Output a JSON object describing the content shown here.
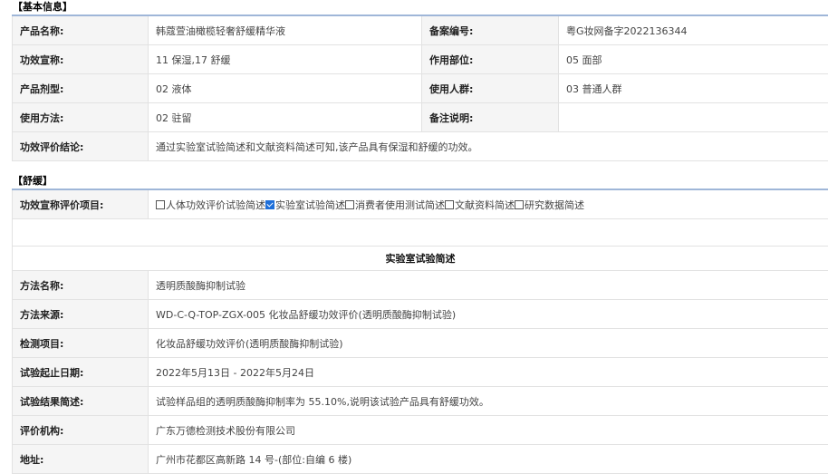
{
  "section1": {
    "title": "【基本信息】",
    "rows": [
      {
        "l1": "产品名称:",
        "v1": "韩蔻萱油橄榄轻奢舒缓精华液",
        "l2": "备案编号:",
        "v2": "粤G妆网备字2022136344"
      },
      {
        "l1": "功效宣称:",
        "v1": "11 保湿,17 舒缓",
        "l2": "作用部位:",
        "v2": "05 面部"
      },
      {
        "l1": "产品剂型:",
        "v1": "02 液体",
        "l2": "使用人群:",
        "v2": "03 普通人群"
      },
      {
        "l1": "使用方法:",
        "v1": "02 驻留",
        "l2": "备注说明:",
        "v2": ""
      }
    ],
    "conclusion_label": "功效评价结论:",
    "conclusion_value": "通过实验室试验简述和文献资料简述可知,该产品具有保湿和舒缓的功效。"
  },
  "section2": {
    "title": "【舒缓】",
    "items_label": "功效宣称评价项目:",
    "checkboxes": [
      {
        "label": "人体功效评价试验简述",
        "checked": false
      },
      {
        "label": "实验室试验简述",
        "checked": true
      },
      {
        "label": "消费者使用测试简述",
        "checked": false
      },
      {
        "label": "文献资料简述",
        "checked": false
      },
      {
        "label": "研究数据简述",
        "checked": false
      }
    ],
    "subheading": "实验室试验简述",
    "rows": [
      {
        "label": "方法名称:",
        "value": "透明质酸酶抑制试验"
      },
      {
        "label": "方法来源:",
        "value": "WD-C-Q-TOP-ZGX-005 化妆品舒缓功效评价(透明质酸酶抑制试验)"
      },
      {
        "label": "检测项目:",
        "value": "化妆品舒缓功效评价(透明质酸酶抑制试验)"
      },
      {
        "label": "试验起止日期:",
        "value": "2022年5月13日 - 2022年5月24日"
      },
      {
        "label": "试验结果简述:",
        "value": "试验样品组的透明质酸酶抑制率为 55.10%,说明该试验产品具有舒缓功效。"
      },
      {
        "label": "评价机构:",
        "value": "广东万德检测技术股份有限公司"
      },
      {
        "label": "地址:",
        "value": "广州市花都区高新路 14 号-(部位:自编 6 楼)"
      }
    ]
  }
}
